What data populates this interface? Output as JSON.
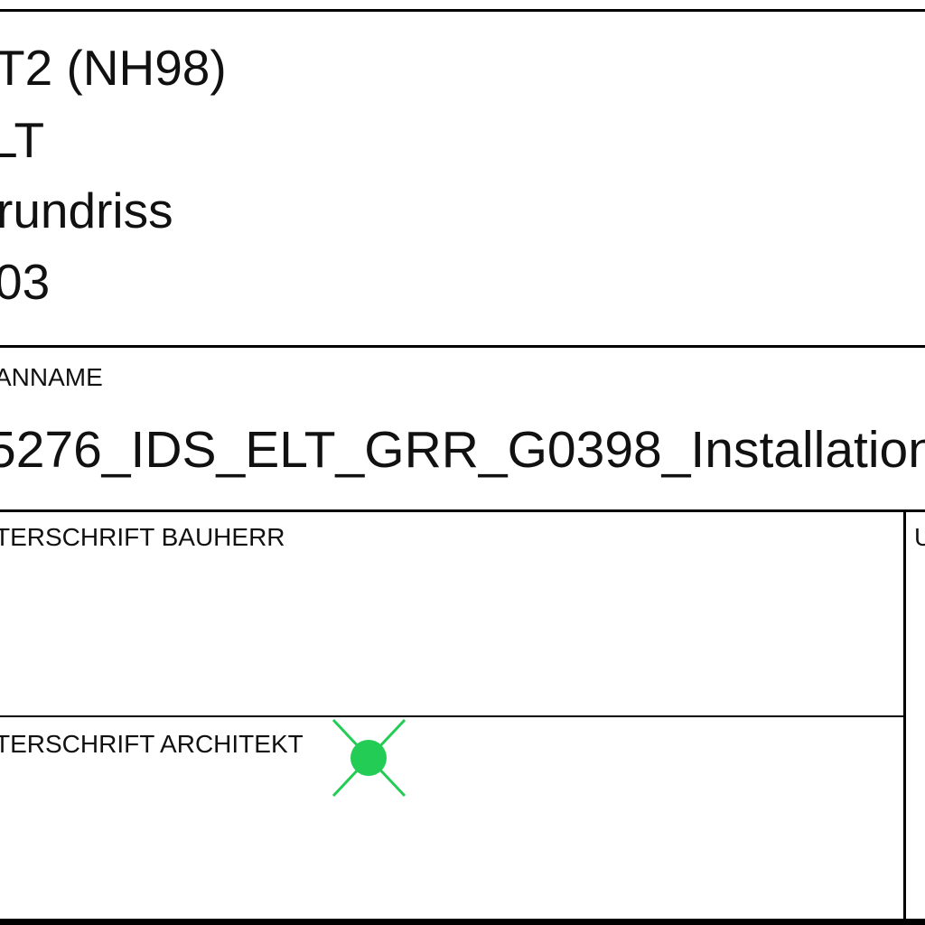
{
  "header": {
    "project": "T2 (NH98)",
    "discipline": "LT",
    "plan_type": "rundriss",
    "number": "03"
  },
  "filename_section": {
    "label": "ANNAME",
    "filename": "5276_IDS_ELT_GRR_G0398_Installation"
  },
  "signatures": {
    "client_label": "TERSCHRIFT BAUHERR",
    "architect_label": "TERSCHRIFT ARCHITEKT",
    "right_label": "U"
  },
  "marker": {
    "color": "#22cc55",
    "icon": "green-cross-dot-icon"
  }
}
